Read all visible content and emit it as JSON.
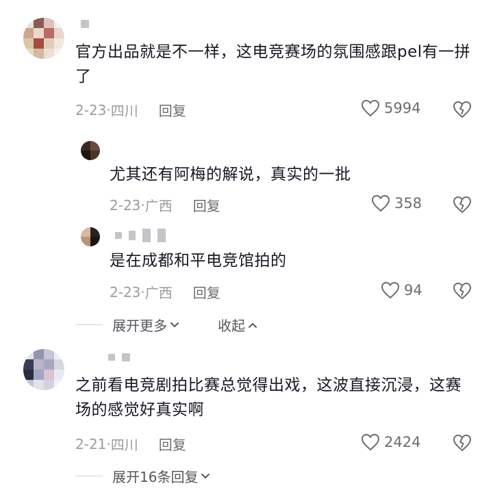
{
  "comments": [
    {
      "text": "官方出品就是不一样，这电竞赛场的氛围感跟pel有一拼了",
      "date": "2-23",
      "location": "四川",
      "reply_label": "回复",
      "likes": "5994"
    },
    {
      "text": "之前看电竞剧拍比赛总觉得出戏，这波直接沉浸，这赛场的感觉好真实啊",
      "date": "2-21",
      "location": "四川",
      "reply_label": "回复",
      "likes": "2424"
    }
  ],
  "replies": [
    {
      "text": "尤其还有阿梅的解说，真实的一批",
      "date": "2-23",
      "location": "广西",
      "reply_label": "回复",
      "likes": "358"
    },
    {
      "text": "是在成都和平电竞馆拍的",
      "date": "2-23",
      "location": "广西",
      "reply_label": "回复",
      "likes": "94"
    }
  ],
  "thread1": {
    "expand_more": "展开更多",
    "collapse": "收起"
  },
  "thread2": {
    "expand_replies": "展开16条回复"
  },
  "icons": [
    "heart-outline-icon",
    "broken-heart-icon",
    "chevron-down-icon",
    "chevron-up-icon"
  ]
}
